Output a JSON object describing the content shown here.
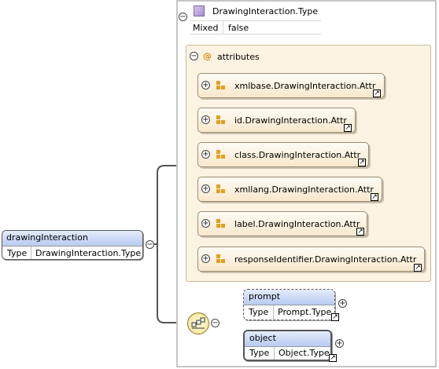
{
  "complex_type": {
    "name": "DrawingInteraction.Type",
    "mixed_label": "Mixed",
    "mixed_value": "false"
  },
  "attributes_group": {
    "at_symbol": "@",
    "title": "attributes",
    "items": [
      {
        "label": "xmlbase.DrawingInteraction.Attr"
      },
      {
        "label": "id.DrawingInteraction.Attr"
      },
      {
        "label": "class.DrawingInteraction.Attr"
      },
      {
        "label": "xmllang.DrawingInteraction.Attr"
      },
      {
        "label": "label.DrawingInteraction.Attr"
      },
      {
        "label": "responseIdentifier.DrawingInteraction.Attr"
      }
    ]
  },
  "root_element": {
    "name": "drawingInteraction",
    "type_label": "Type",
    "type_value": "DrawingInteraction.Type"
  },
  "children": [
    {
      "name": "prompt",
      "type_label": "Type",
      "type_value": "Prompt.Type",
      "optional": true
    },
    {
      "name": "object",
      "type_label": "Type",
      "type_value": "Object.Type",
      "optional": false
    }
  ],
  "glyphs": {
    "collapse": "−",
    "expand": "+",
    "external": "↗"
  }
}
